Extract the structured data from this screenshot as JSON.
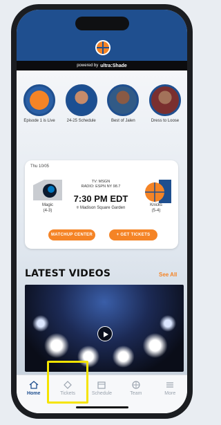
{
  "sponsor": {
    "prefix": "powered by",
    "brand": "ultra:Shade"
  },
  "stories": [
    {
      "label": "Episode 1 is Live"
    },
    {
      "label": "24-25 Schedule"
    },
    {
      "label": "Best of Jalen"
    },
    {
      "label": "Dress to Loose"
    }
  ],
  "game": {
    "date": "Thu 10/05",
    "broadcast_line1": "TV: MSGN",
    "broadcast_line2": "RADIO: ESPN NY 98.7",
    "time": "7:30 PM EDT",
    "venue": "Madison Square Garden",
    "away_name": "Magic",
    "away_record": "(4-3)",
    "home_name": "Knicks",
    "home_record": "(5-4)",
    "btn_left": "MATCHUP CENTER",
    "btn_right": "GET TICKETS"
  },
  "latest": {
    "title": "LATEST VIDEOS",
    "see_all": "See All"
  },
  "tabs": [
    {
      "label": "Home"
    },
    {
      "label": "Tickets"
    },
    {
      "label": "Schedule"
    },
    {
      "label": "Team"
    },
    {
      "label": "More"
    }
  ],
  "colors": {
    "primary": "#1f4f8f",
    "accent": "#f58426",
    "highlight": "#f5e400"
  }
}
